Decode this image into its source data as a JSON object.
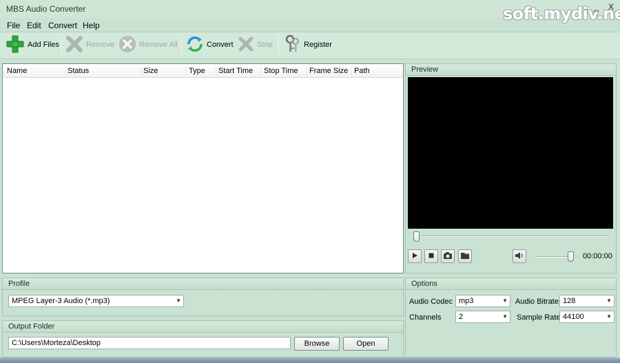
{
  "window": {
    "title": "MBS Audio Converter",
    "watermark": "soft.mydiv.net",
    "minimize_glyph": "_",
    "close_glyph": "X"
  },
  "menu": [
    {
      "label": "File"
    },
    {
      "label": "Edit"
    },
    {
      "label": "Convert"
    },
    {
      "label": "Help"
    }
  ],
  "toolbar": {
    "add_files": "Add Files",
    "remove": "Remove",
    "remove_all": "Remove All",
    "convert": "Convert",
    "stop": "Stop",
    "register": "Register"
  },
  "file_list": {
    "columns": [
      "Name",
      "Status",
      "Size",
      "Type",
      "Start Time",
      "Stop Time",
      "Frame Size",
      "Path"
    ]
  },
  "preview": {
    "title": "Preview",
    "time": "00:00:00",
    "seek_position": 0,
    "volume_level": 1.0
  },
  "profile": {
    "title": "Profile",
    "selected": "MPEG Layer-3 Audio (*.mp3)"
  },
  "output_folder": {
    "title": "Output Folder",
    "path": "C:\\Users\\Morteza\\Desktop",
    "browse": "Browse",
    "open": "Open"
  },
  "options": {
    "title": "Options",
    "audio_codec_label": "Audio Codec",
    "audio_codec": "mp3",
    "audio_bitrate_label": "Audio Bitrate",
    "audio_bitrate": "128",
    "channels_label": "Channels",
    "channels": "2",
    "sample_rate_label": "Sample Rate",
    "sample_rate": "44100"
  },
  "colors": {
    "window_bg": "#c9e2d2",
    "preview_bg": "#000000",
    "add_icon": "#2fa83a",
    "disabled_text": "#9aa8a0"
  }
}
